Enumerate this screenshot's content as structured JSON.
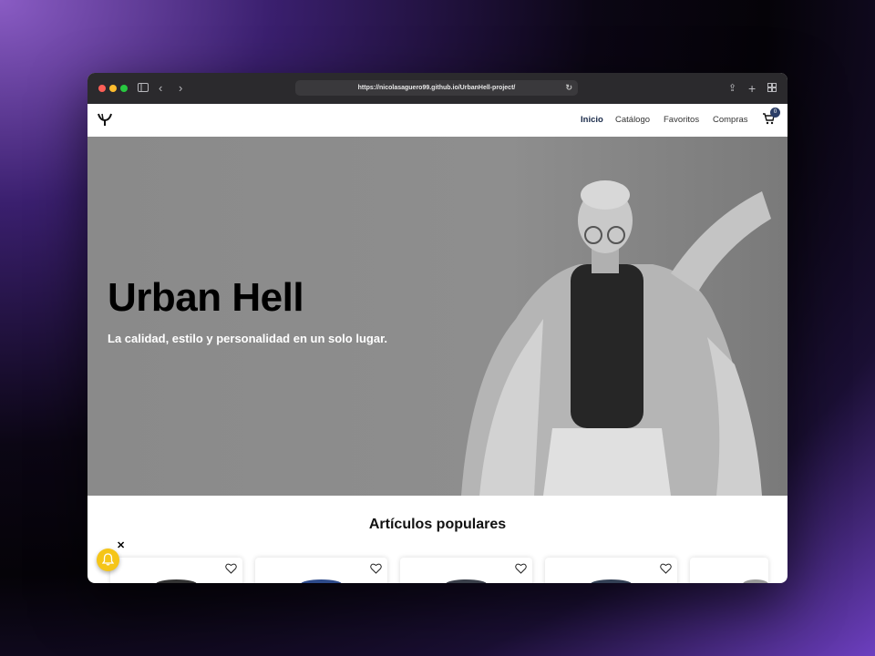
{
  "browser": {
    "url": "https://nicolasaguero99.github.io/UrbanHell-project/"
  },
  "nav": {
    "links": [
      "Inicio",
      "Catálogo",
      "Favoritos",
      "Compras"
    ],
    "cart_count": "0"
  },
  "hero": {
    "title": "Urban Hell",
    "subtitle": "La calidad, estilo y personalidad en un solo lugar."
  },
  "popular": {
    "title": "Artículos populares",
    "card_count": 5
  },
  "colors": {
    "brand_navy": "#1a2b4a",
    "notification_yellow": "#f5c518"
  },
  "icons": [
    "sidebar-icon",
    "back-icon",
    "forward-icon",
    "reload-icon",
    "share-icon",
    "new-tab-icon",
    "tabs-overview-icon",
    "logo-icon",
    "cart-icon",
    "heart-icon",
    "bell-icon",
    "close-icon"
  ]
}
